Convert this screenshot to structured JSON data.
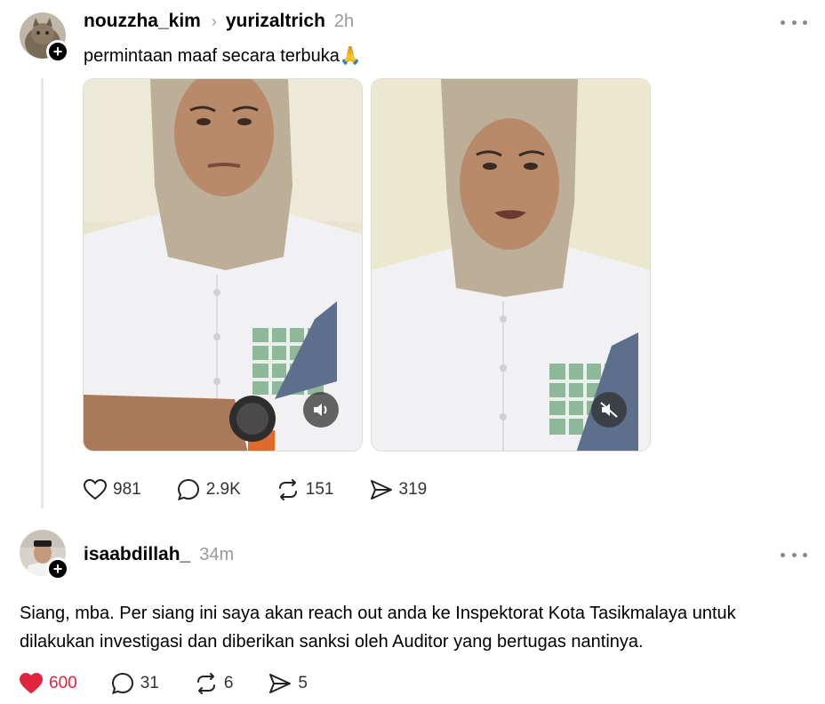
{
  "post": {
    "username": "nouzzha_kim",
    "reply_to": "yurizaltrich",
    "time": "2h",
    "text": "permintaan maaf secara terbuka🙏",
    "stats": {
      "likes": "981",
      "comments": "2.9K",
      "reposts": "151",
      "shares": "319"
    },
    "videos": [
      {
        "audio_icon": "speaker-on-icon"
      },
      {
        "audio_icon": "speaker-muted-icon"
      }
    ]
  },
  "reply": {
    "username": "isaabdillah_",
    "time": "34m",
    "text": "Siang, mba. Per siang ini saya akan reach out anda ke Inspektorat Kota Tasikmalaya untuk dilakukan investigasi dan diberikan sanksi oleh Auditor yang bertugas nantinya.",
    "stats": {
      "likes": "600",
      "comments": "31",
      "reposts": "6",
      "shares": "5"
    },
    "liked": true
  },
  "colors": {
    "like_active": "#e0243e",
    "muted_text": "#999999",
    "thread_line": "#e6e6e6"
  }
}
